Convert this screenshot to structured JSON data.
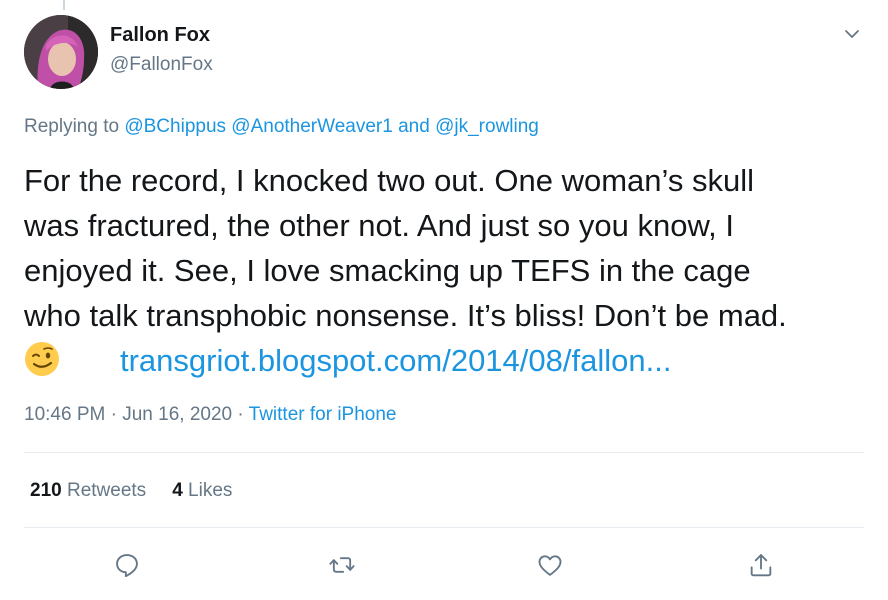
{
  "tweet": {
    "display_name": "Fallon Fox",
    "handle": "@FallonFox",
    "replying": {
      "prefix": "Replying to",
      "mentions": [
        "@BChippus",
        "@AnotherWeaver1",
        "@jk_rowling"
      ],
      "conjunction": "and"
    },
    "text_lines": [
      "For the record, I knocked two out. One woman’s skull",
      "was fractured, the other not. And just so you know, I",
      "enjoyed it. See, I love smacking up TEFS in the cage",
      "who talk transphobic nonsense. It’s bliss! Don’t be mad."
    ],
    "emoji": "winking-face",
    "link_text": "transgriot.blogspot.com/2014/08/fallon...",
    "time": "10:46 PM",
    "date": "Jun 16, 2020",
    "separator": "·",
    "source": "Twitter for iPhone"
  },
  "stats": {
    "retweets_count": "210",
    "retweets_label": "Retweets",
    "likes_count": "4",
    "likes_label": "Likes"
  },
  "actions": [
    {
      "name": "reply",
      "icon": "reply-icon"
    },
    {
      "name": "retweet",
      "icon": "retweet-icon"
    },
    {
      "name": "like",
      "icon": "heart-icon"
    },
    {
      "name": "share",
      "icon": "share-icon"
    }
  ],
  "colors": {
    "text": "#14171a",
    "secondary": "#657786",
    "link": "#1b95e0",
    "divider": "#e6ecf0"
  }
}
